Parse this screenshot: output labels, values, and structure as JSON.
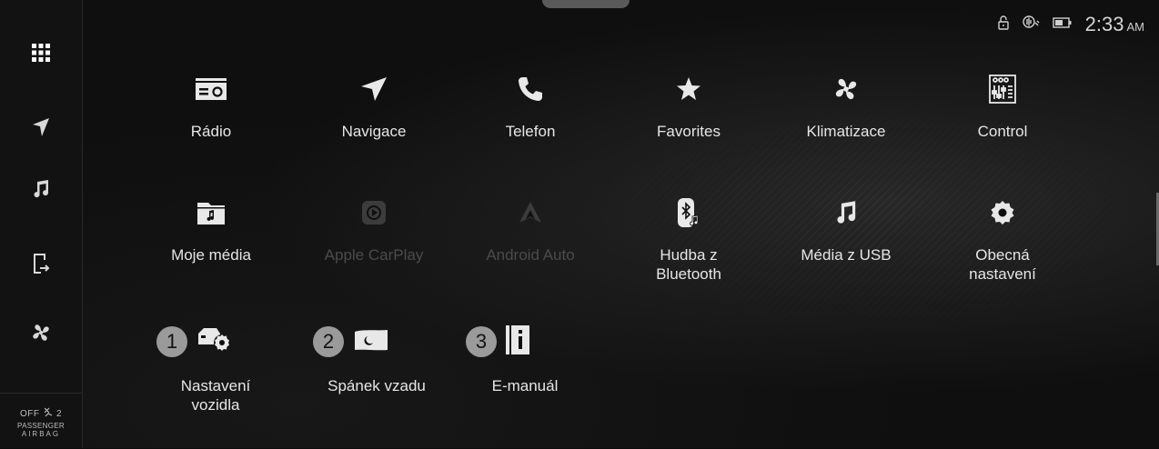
{
  "status": {
    "time": "2:33",
    "ampm": "AM",
    "icons": [
      "lock-icon",
      "voice-recognition-icon",
      "battery-icon"
    ]
  },
  "sidebar": {
    "items": [
      {
        "name": "apps-grid-icon"
      },
      {
        "name": "navigation-icon"
      },
      {
        "name": "music-icon"
      },
      {
        "name": "phone-projection-icon"
      },
      {
        "name": "climate-fan-icon"
      }
    ],
    "airbag": {
      "state": "OFF",
      "seat": "2",
      "line1": "PASSENGER",
      "line2": "AIRBAG"
    }
  },
  "apps": [
    {
      "label": "Rádio",
      "icon": "radio-icon"
    },
    {
      "label": "Navigace",
      "icon": "navigation-icon"
    },
    {
      "label": "Telefon",
      "icon": "phone-icon"
    },
    {
      "label": "Favorites",
      "icon": "star-icon"
    },
    {
      "label": "Klimatizace",
      "icon": "fan-icon"
    },
    {
      "label": "Control",
      "icon": "control-panel-icon"
    },
    {
      "label": "Moje média",
      "icon": "folder-music-icon"
    },
    {
      "label": "Apple CarPlay",
      "icon": "carplay-icon"
    },
    {
      "label": "Android Auto",
      "icon": "android-auto-icon"
    },
    {
      "label": "Hudba z\nBluetooth",
      "icon": "bluetooth-music-icon"
    },
    {
      "label": "Média z USB",
      "icon": "usb-music-icon"
    },
    {
      "label": "Obecná\nnastavení",
      "icon": "settings-gear-icon"
    }
  ],
  "numbered": [
    {
      "num": "1",
      "label": "Nastavení\nvozidla",
      "icon": "car-settings-icon"
    },
    {
      "num": "2",
      "label": "Spánek vzadu",
      "icon": "rear-sleep-icon"
    },
    {
      "num": "3",
      "label": "E-manuál",
      "icon": "e-manual-icon"
    }
  ],
  "colors": {
    "background": "#0d0d0d",
    "text": "#e6e6e6",
    "disabled": "#4b4b4b",
    "badge": "#9a9a9a"
  }
}
